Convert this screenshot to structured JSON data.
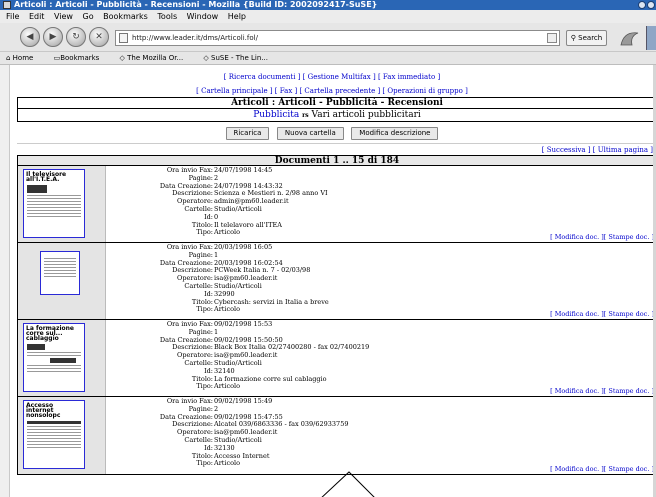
{
  "window": {
    "title": "Articoli : Articoli - Pubblicità - Recensioni - Mozilla {Build ID: 2002092417-SuSE}"
  },
  "menu": [
    "File",
    "Edit",
    "View",
    "Go",
    "Bookmarks",
    "Tools",
    "Window",
    "Help"
  ],
  "nav": {
    "url": "http://www.leader.it/dms/Articoli.fol/",
    "search_label": "Search"
  },
  "bookmarks": [
    "Home",
    "Bookmarks",
    "The Mozilla Or...",
    "SuSE - The Lin..."
  ],
  "page": {
    "links_row1": [
      "Ricerca documenti",
      "Gestione Multifax",
      "Fax immediato"
    ],
    "links_row2": [
      "Cartella principale",
      "Fax",
      "Cartella precedente",
      "Operazioni di gruppo"
    ],
    "heading": "Articoli : Articoli - Pubblicità - Recensioni",
    "sub_link": "Pubblicita",
    "sub_sep": "rs",
    "sub_text": "Vari articoli pubblicitari",
    "buttons": [
      "Ricarica",
      "Nuova cartella",
      "Modifica descrizione"
    ],
    "pager": [
      "Successiva",
      "Ultima pagina"
    ],
    "docs_header": "Documenti 1 .. 15 di 184",
    "labels": {
      "ora": "Ora invio Fax:",
      "pagine": "Pagine:",
      "data": "Data Creazione:",
      "descr": "Descrizione:",
      "oper": "Operatore:",
      "cart": "Cartelle:",
      "id": "Id:",
      "titolo": "Titolo:",
      "tipo": "Tipo:"
    },
    "action_modify": "Modifica doc.",
    "action_print": "Stampe doc.",
    "documents": [
      {
        "thumb_title": "Il televisore all'I.T.E.A.",
        "ora": "24/07/1998 14:45",
        "pagine": "2",
        "data": "24/07/1998 14:43:32",
        "descr": "Scienza e Mestieri n. 2/98 anno VI",
        "oper": "admin@pm60.leader.it",
        "cart": "Studio/Articoli",
        "id": "0",
        "titolo": "Il telelavoro all'ITEA",
        "tipo": "Articolo"
      },
      {
        "thumb_title": "",
        "ora": "20/03/1998 16:05",
        "pagine": "1",
        "data": "20/03/1998 16:02:54",
        "descr": "PCWeek Italia n. 7 - 02/03/98",
        "oper": "isa@pm60.leader.it",
        "cart": "Studio/Articoli",
        "id": "32990",
        "titolo": "Cybercash: servizi in Italia a breve",
        "tipo": "Articolo"
      },
      {
        "thumb_title": "La formazione corre sul... cablaggio",
        "ora": "09/02/1998 15:53",
        "pagine": "1",
        "data": "09/02/1998 15:50:50",
        "descr": "Black Box Italia 02/27400280 - fax 02/7400219",
        "oper": "isa@pm60.leader.it",
        "cart": "Studio/Articoli",
        "id": "32140",
        "titolo": "La formazione corre sul cablaggio",
        "tipo": "Articolo"
      },
      {
        "thumb_title": "Accesso internet nonsolopc",
        "ora": "09/02/1998 15:49",
        "pagine": "2",
        "data": "09/02/1998 15:47:55",
        "descr": "Alcatel 039/6863336 - fax 039/62933759",
        "oper": "isa@pm60.leader.it",
        "cart": "Studio/Articoli",
        "id": "32130",
        "titolo": "Accesso Internet",
        "tipo": "Articolo"
      }
    ]
  }
}
